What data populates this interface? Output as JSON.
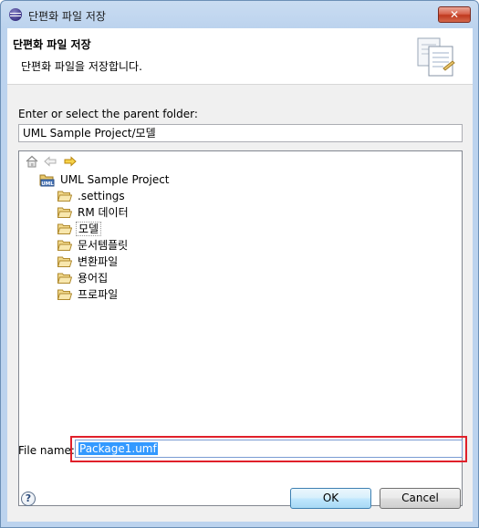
{
  "window": {
    "title": "단편화 파일 저장",
    "close_label": "✕"
  },
  "header": {
    "title": "단편화 파일 저장",
    "description": "단편화 파일을 저장합니다."
  },
  "parent_folder": {
    "label": "Enter or select the parent folder:",
    "value": "UML Sample Project/모델"
  },
  "tree": {
    "toolbar_icons": [
      "home-icon",
      "back-arrow-icon",
      "forward-arrow-icon"
    ],
    "project": "UML Sample Project",
    "folders": [
      ".settings",
      "RM 데이터",
      "모델",
      "문서템플릿",
      "변환파일",
      "용어집",
      "프로파일"
    ],
    "selected": "모델"
  },
  "file_name": {
    "label": "File name:",
    "value": "Package1.umf"
  },
  "buttons": {
    "help": "?",
    "ok": "OK",
    "cancel": "Cancel"
  },
  "colors": {
    "highlight_border": "#e0202a",
    "selection": "#3399ff",
    "title_bar": "#bcd3ee"
  }
}
